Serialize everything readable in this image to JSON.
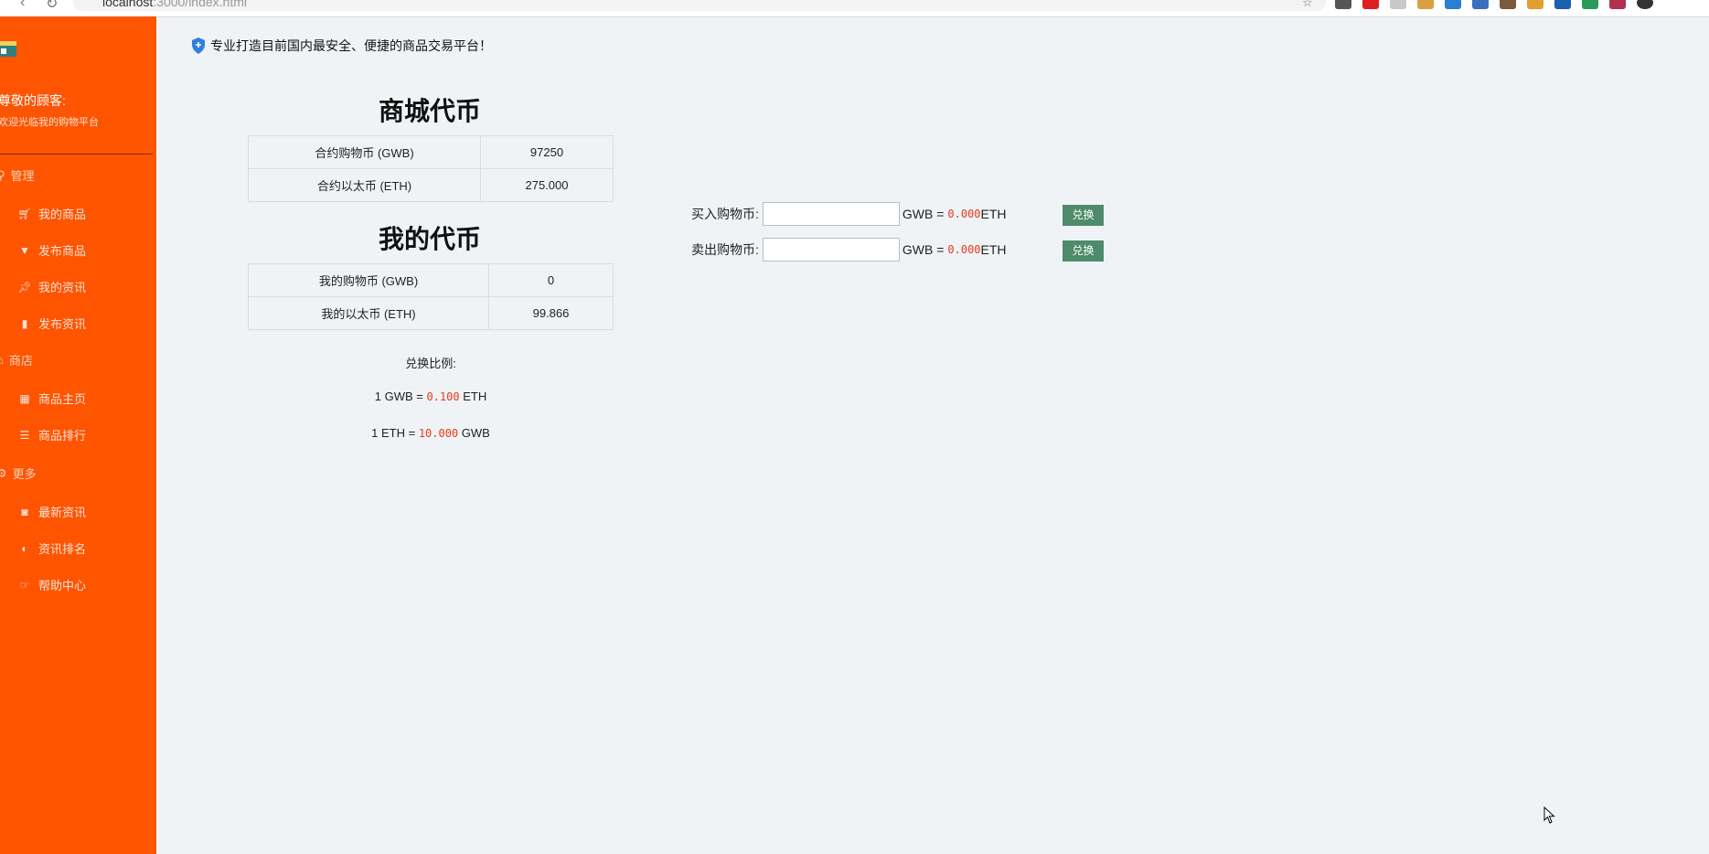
{
  "browser": {
    "url_host": "localhost",
    "url_rest": ":3000/index.html"
  },
  "sidebar": {
    "greeting": "尊敬的顾客:",
    "welcome": "欢迎光临我的购物平台",
    "sections": [
      {
        "label": "管理",
        "icon": "user-icon",
        "items": [
          {
            "label": "我的商品",
            "icon": "cart-icon"
          },
          {
            "label": "发布商品",
            "icon": "filter-icon"
          },
          {
            "label": "我的资讯",
            "icon": "pin-icon"
          },
          {
            "label": "发布资讯",
            "icon": "book-icon"
          }
        ]
      },
      {
        "label": "商店",
        "icon": "home-icon",
        "items": [
          {
            "label": "商品主页",
            "icon": "grid-icon"
          },
          {
            "label": "商品排行",
            "icon": "list-icon"
          }
        ]
      },
      {
        "label": "更多",
        "icon": "gear-icon",
        "items": [
          {
            "label": "最新资讯",
            "icon": "camera-icon"
          },
          {
            "label": "资讯排名",
            "icon": "contrast-icon"
          },
          {
            "label": "帮助中心",
            "icon": "hand-icon"
          }
        ]
      }
    ]
  },
  "notice": "专业打造目前国内最安全、便捷的商品交易平台！",
  "mall_tokens": {
    "title": "商城代币",
    "rows": [
      {
        "label": "合约购物币 (GWB)",
        "value": "97250"
      },
      {
        "label": "合约以太币 (ETH)",
        "value": "275.000"
      }
    ]
  },
  "my_tokens": {
    "title": "我的代币",
    "rows": [
      {
        "label": "我的购物币 (GWB)",
        "value": "0"
      },
      {
        "label": "我的以太币 (ETH)",
        "value": "99.866"
      }
    ]
  },
  "rates": {
    "label": "兑换比例:",
    "gwb_prefix": "1 GWB = ",
    "gwb_value": "0.100",
    "gwb_suffix": " ETH",
    "eth_prefix": "1 ETH = ",
    "eth_value": "10.000",
    "eth_suffix": " GWB"
  },
  "exchange": {
    "buy": {
      "label": "买入购物币:",
      "value": "",
      "unit": "GWB = ",
      "result": "0.000",
      "result_unit": " ETH",
      "button": "兑换"
    },
    "sell": {
      "label": "卖出购物币:",
      "value": "",
      "unit": "GWB = ",
      "result": "0.000",
      "result_unit": " ETH",
      "button": "兑换"
    }
  },
  "colors": {
    "sidebar": "#ff5400",
    "background": "#eff3f6",
    "accent_value": "#e83a1a",
    "button": "#4e8b6a"
  }
}
